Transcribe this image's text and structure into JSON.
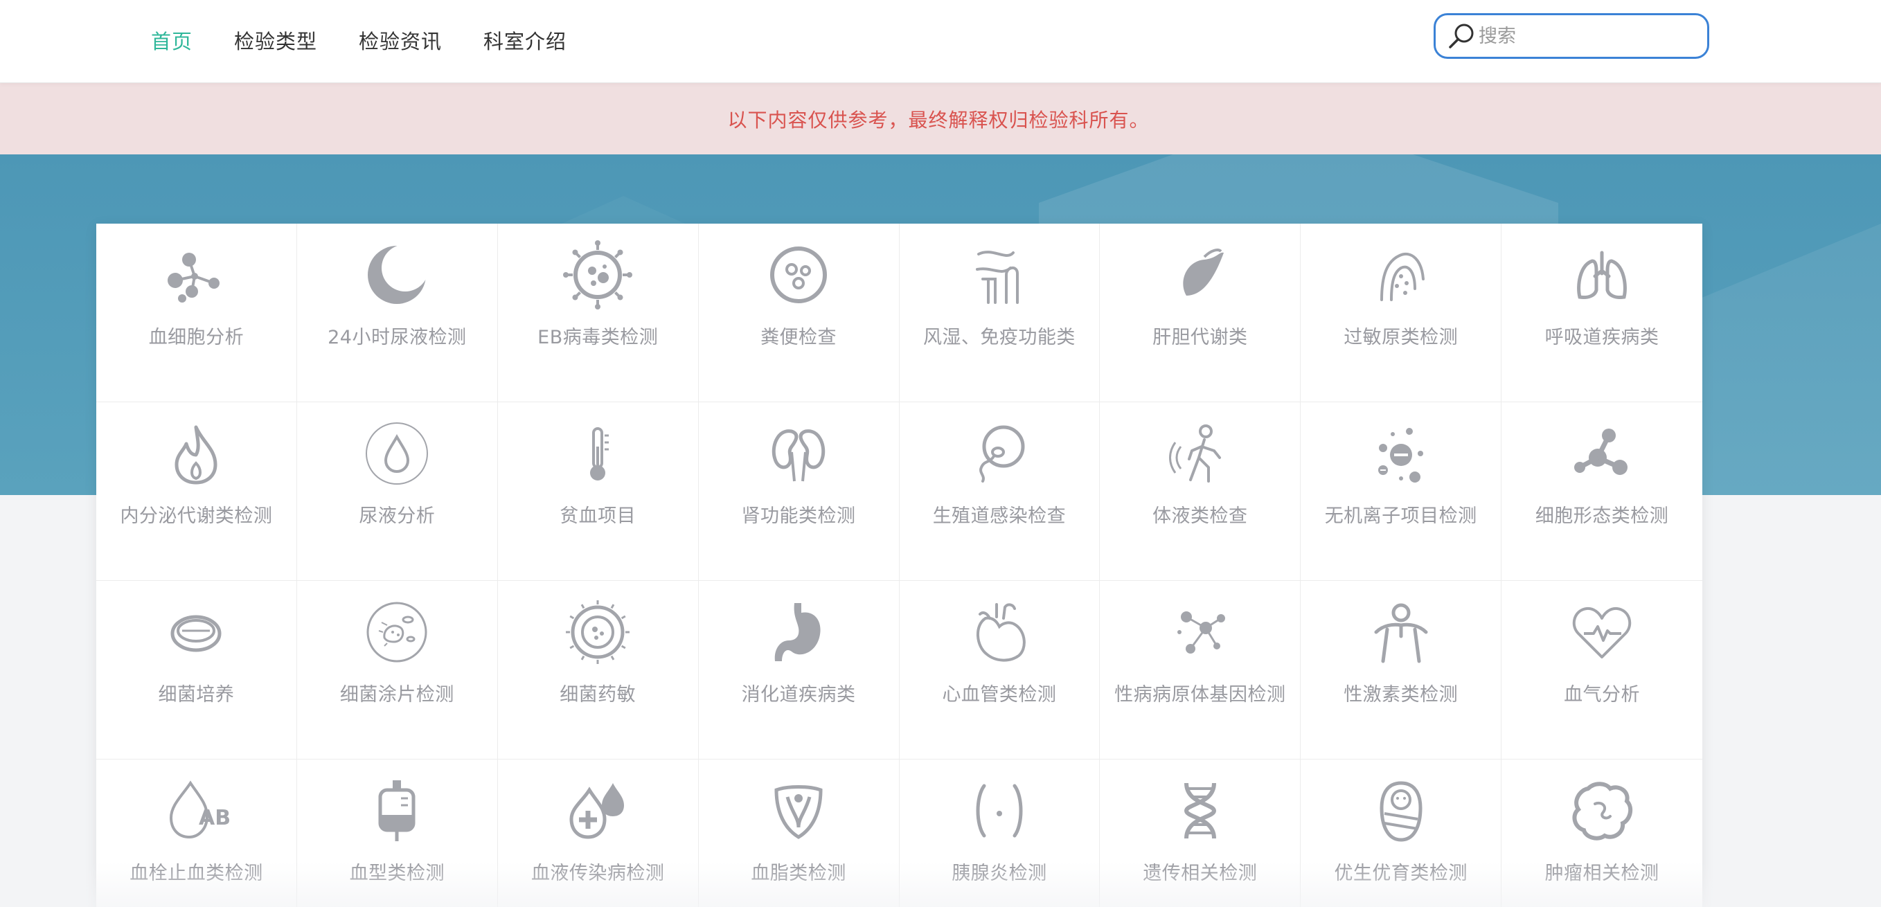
{
  "nav": {
    "items": [
      {
        "label": "首页",
        "active": true
      },
      {
        "label": "检验类型",
        "active": false
      },
      {
        "label": "检验资讯",
        "active": false
      },
      {
        "label": "科室介绍",
        "active": false
      }
    ],
    "active_color": "#2fb79a"
  },
  "search": {
    "placeholder": "搜索",
    "value": ""
  },
  "notice": {
    "text": "以下内容仅供参考，最终解释权归检验科所有。",
    "color": "#d9534f"
  },
  "theme": {
    "hero_color": "#4d97b6",
    "icon_color": "#a3a5ab"
  },
  "categories": [
    {
      "label": "血细胞分析",
      "icon": "molecule-icon"
    },
    {
      "label": "24小时尿液检测",
      "icon": "moon-icon"
    },
    {
      "label": "EB病毒类检测",
      "icon": "virus-icon"
    },
    {
      "label": "粪便检查",
      "icon": "stool-icon"
    },
    {
      "label": "风湿、免疫功能类",
      "icon": "joint-icon"
    },
    {
      "label": "肝胆代谢类",
      "icon": "liver-icon"
    },
    {
      "label": "过敏原类检测",
      "icon": "allergy-icon"
    },
    {
      "label": "呼吸道疾病类",
      "icon": "lungs-icon"
    },
    {
      "label": "内分泌代谢类检测",
      "icon": "flame-icon"
    },
    {
      "label": "尿液分析",
      "icon": "drop-icon"
    },
    {
      "label": "贫血项目",
      "icon": "thermometer-icon"
    },
    {
      "label": "肾功能类检测",
      "icon": "kidney-icon"
    },
    {
      "label": "生殖道感染检查",
      "icon": "sperm-icon"
    },
    {
      "label": "体液类检查",
      "icon": "runner-icon"
    },
    {
      "label": "无机离子项目检测",
      "icon": "ions-icon"
    },
    {
      "label": "细胞形态类检测",
      "icon": "cell-cluster-icon"
    },
    {
      "label": "细菌培养",
      "icon": "petri-dish-icon"
    },
    {
      "label": "细菌涂片检测",
      "icon": "bacteria-icon"
    },
    {
      "label": "细菌药敏",
      "icon": "microscope-slide-icon"
    },
    {
      "label": "消化道疾病类",
      "icon": "stomach-icon"
    },
    {
      "label": "心血管类检测",
      "icon": "heart-organ-icon"
    },
    {
      "label": "性病病原体基因检测",
      "icon": "network-icon"
    },
    {
      "label": "性激素类检测",
      "icon": "person-icon"
    },
    {
      "label": "血气分析",
      "icon": "heart-pulse-icon"
    },
    {
      "label": "血栓止血类检测",
      "icon": "blood-type-icon"
    },
    {
      "label": "血型类检测",
      "icon": "blood-bag-icon"
    },
    {
      "label": "血液传染病检测",
      "icon": "blood-cross-icon"
    },
    {
      "label": "血脂类检测",
      "icon": "pelvis-icon"
    },
    {
      "label": "胰腺炎检测",
      "icon": "pancreas-icon"
    },
    {
      "label": "遗传相关检测",
      "icon": "dna-icon"
    },
    {
      "label": "优生优育类检测",
      "icon": "baby-icon"
    },
    {
      "label": "肿瘤相关检测",
      "icon": "tumor-icon"
    }
  ]
}
